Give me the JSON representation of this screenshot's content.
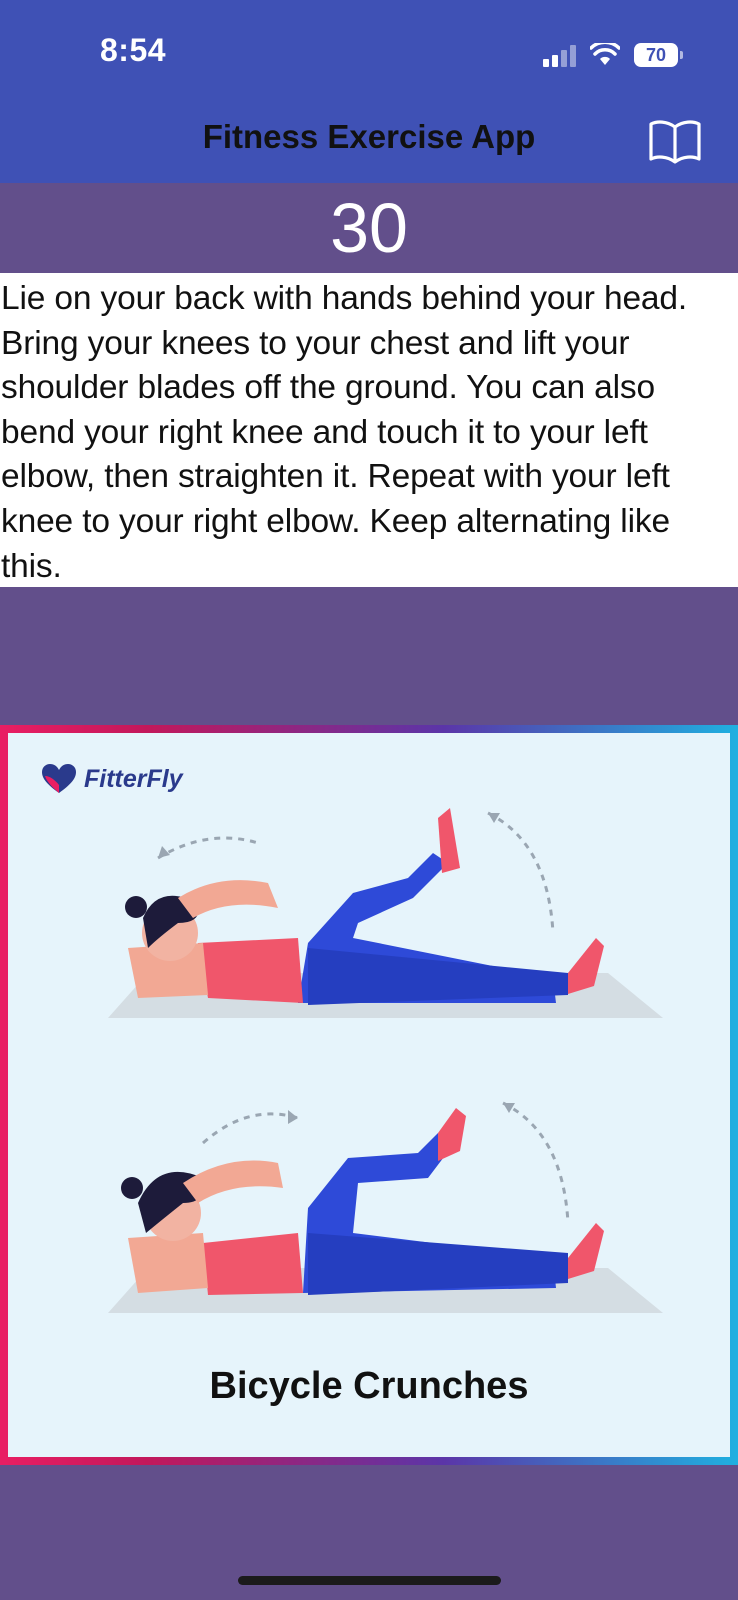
{
  "status_bar": {
    "time": "8:54",
    "battery": "70"
  },
  "header": {
    "title": "Fitness Exercise App",
    "book_icon": "book-icon"
  },
  "counter": {
    "value": "30"
  },
  "description": "Lie on your back with hands behind your head. Bring your knees to your chest and lift your shoulder blades off the ground. You can also bend your right knee and touch it to your left elbow, then straighten it. Repeat with your left knee to your right elbow. Keep alternating like this.",
  "exercise_image": {
    "brand": "FitterFly",
    "caption": "Bicycle Crunches"
  },
  "colors": {
    "header_bg": "#3f51b5",
    "page_bg": "#624f8b",
    "image_bg": "#e6f4fb",
    "frame_gradient": [
      "#e91e63",
      "#5b35a8",
      "#1fb0e0"
    ]
  }
}
